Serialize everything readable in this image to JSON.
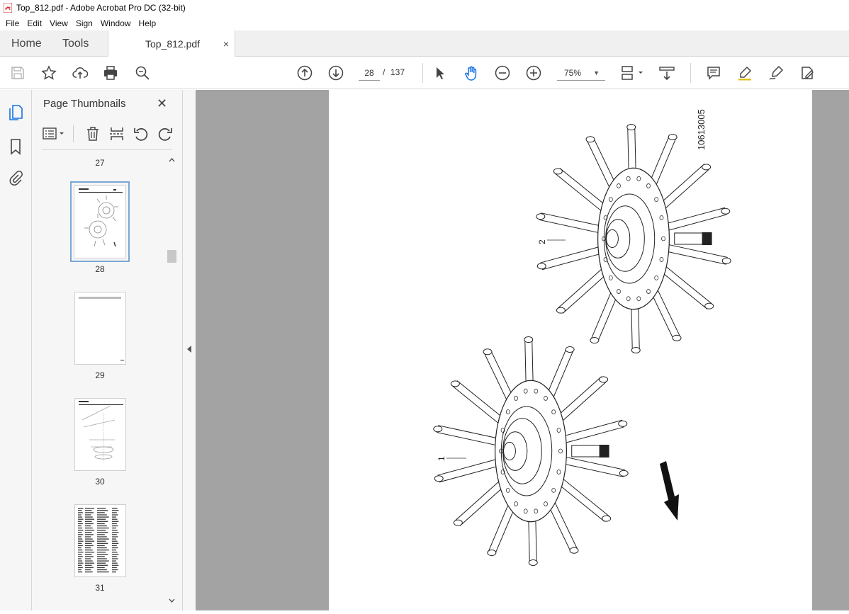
{
  "window": {
    "title": "Top_812.pdf - Adobe Acrobat Pro DC (32-bit)"
  },
  "menu": {
    "items": [
      "File",
      "Edit",
      "View",
      "Sign",
      "Window",
      "Help"
    ]
  },
  "tabs": {
    "home": "Home",
    "tools": "Tools",
    "document": "Top_812.pdf",
    "close": "×"
  },
  "toolbar": {
    "current_page": "28",
    "separator": "/",
    "total_pages": "137",
    "zoom": "75%"
  },
  "thumbnails_panel": {
    "title": "Page Thumbnails",
    "close": "✕",
    "pages": [
      {
        "label": "27"
      },
      {
        "label": "28"
      },
      {
        "label": "29"
      },
      {
        "label": "30"
      },
      {
        "label": "31"
      }
    ]
  },
  "document_page": {
    "figure_id": "10613005",
    "callout_1": "1",
    "callout_2": "2"
  },
  "colors": {
    "accent": "#1473e6",
    "selected_outline": "#7aa7d6",
    "viewer_bg": "#a3a3a3",
    "pdf_icon_red": "#d32f2f"
  }
}
